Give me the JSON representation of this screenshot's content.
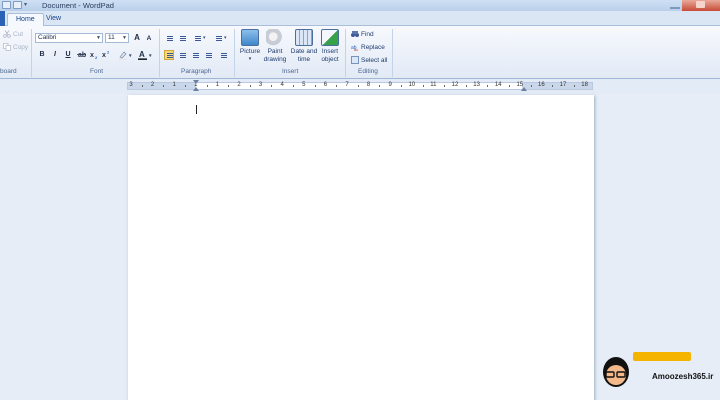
{
  "window": {
    "title": "Document - WordPad"
  },
  "tabs": [
    {
      "label": "Home"
    },
    {
      "label": "View"
    }
  ],
  "clipboard": {
    "label": "board",
    "cut": "Cut",
    "copy": "Copy"
  },
  "font": {
    "label": "Font",
    "family": "Calibri",
    "size": "11",
    "bold": "B",
    "italic": "I",
    "underline": "U",
    "grow": "A",
    "shrink": "A"
  },
  "paragraph": {
    "label": "Paragraph"
  },
  "insert": {
    "label": "Insert",
    "picture": "Picture",
    "paint_line1": "Paint",
    "paint_line2": "drawing",
    "date_line1": "Date and",
    "date_line2": "time",
    "object_line1": "Insert",
    "object_line2": "object"
  },
  "editing": {
    "label": "Editing",
    "find": "Find",
    "replace": "Replace",
    "select_all": "Select all"
  },
  "ruler": {
    "labels": [
      "3",
      "2",
      "1",
      "1",
      "1",
      "2",
      "3",
      "4",
      "5",
      "6",
      "7",
      "8",
      "9",
      "10",
      "11",
      "12",
      "13",
      "14",
      "15",
      "16",
      "17",
      "18"
    ]
  },
  "watermark": {
    "site": "Amoozesh365.ir"
  },
  "colors": {
    "accent": "#2b62b6",
    "ribbon_bg": "#e2eaf6",
    "page_bg": "#ffffff"
  }
}
